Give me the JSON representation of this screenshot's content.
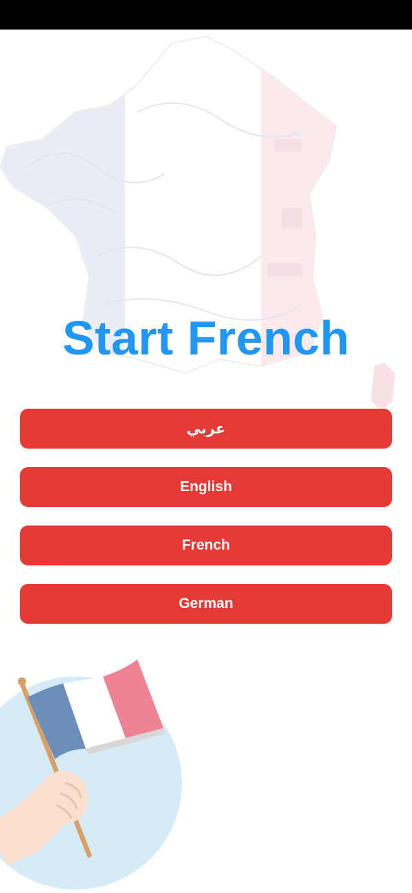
{
  "app": {
    "title": "Start French"
  },
  "languages": [
    {
      "label": "عربي"
    },
    {
      "label": "English"
    },
    {
      "label": "French"
    },
    {
      "label": "German"
    }
  ],
  "colors": {
    "title": "#2196F3",
    "button": "#E53935",
    "button_text": "#FFFFFF",
    "flag_blue": "#6B8FB8",
    "flag_white": "#FFFFFF",
    "flag_red": "#EE8394",
    "circle": "#D6EBF8",
    "status_bar": "#000000"
  },
  "icons": {
    "background": "france-map-icon",
    "illustration": "hand-holding-french-flag-icon"
  }
}
